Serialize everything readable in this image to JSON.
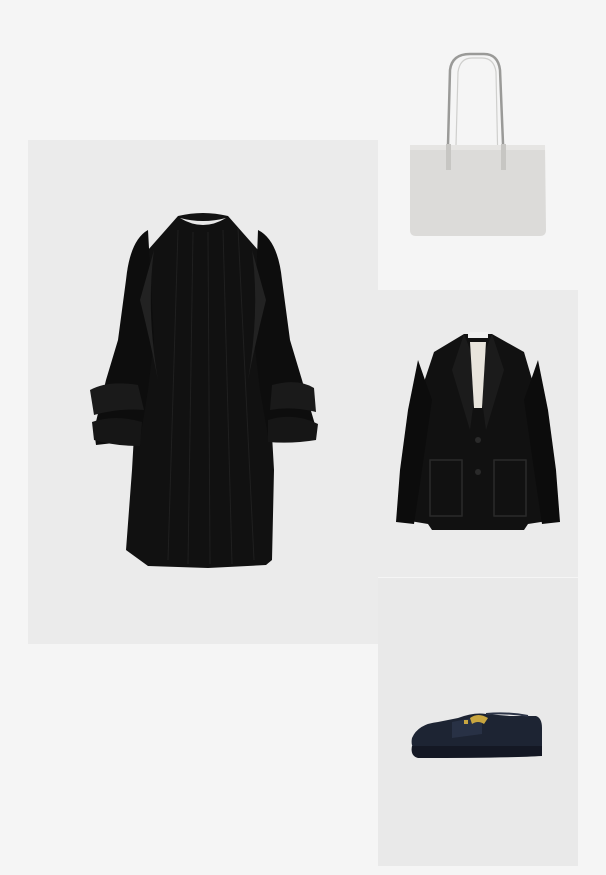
{
  "outfit": {
    "items": [
      {
        "id": "dress",
        "icon": "black-ruffle-dress-image",
        "background": "#ebebeb"
      },
      {
        "id": "bag",
        "icon": "light-grey-tote-bag-image",
        "background": "#f5f5f5"
      },
      {
        "id": "blazer",
        "icon": "black-blazer-image",
        "background": "#ebebeb"
      },
      {
        "id": "loafer",
        "icon": "navy-suede-loafer-image",
        "background": "#e9e9e9"
      }
    ],
    "colors": {
      "page_background": "#f5f5f5",
      "garment_black": "#111111",
      "bag_grey": "#dcdbd9",
      "loafer_navy": "#1d2433",
      "buckle_gold": "#c9a640"
    }
  }
}
